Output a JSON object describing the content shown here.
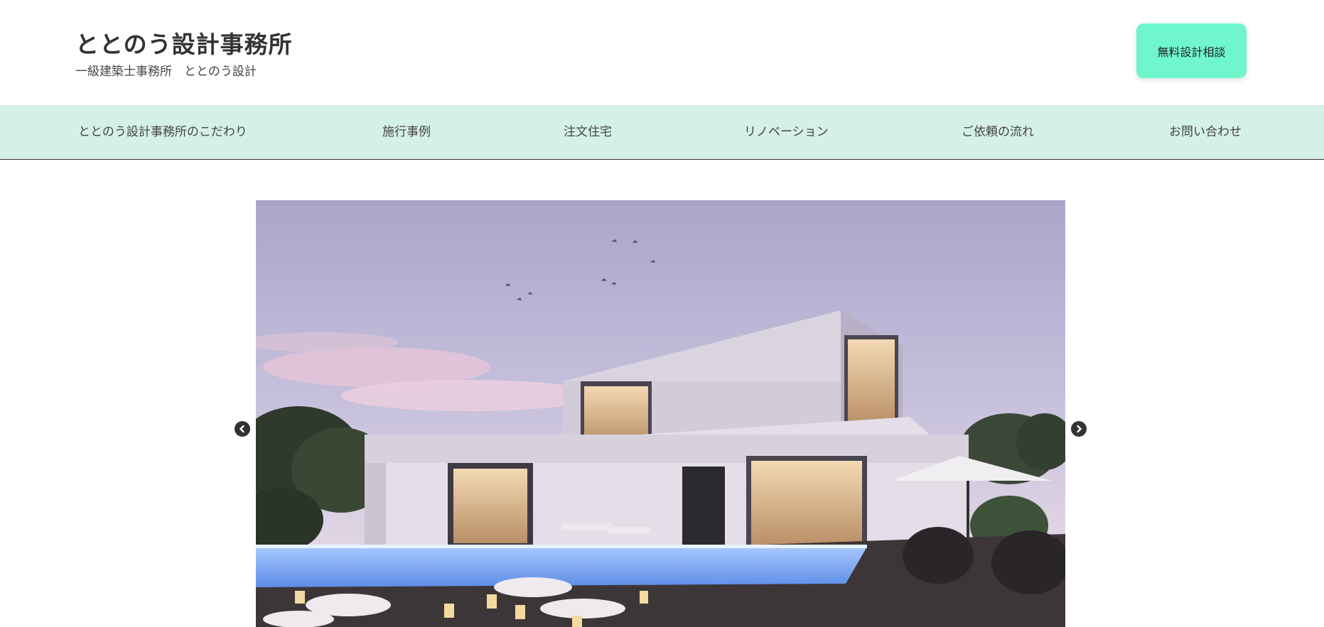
{
  "header": {
    "title": "ととのう設計事務所",
    "subtitle": "一級建築士事務所　ととのう設計",
    "cta_label": "無料設計相談"
  },
  "nav": {
    "items": [
      {
        "label": "ととのう設計事務所のこだわり"
      },
      {
        "label": "施行事例"
      },
      {
        "label": "注文住宅"
      },
      {
        "label": "リノベーション"
      },
      {
        "label": "ご依頼の流れ"
      },
      {
        "label": "お問い合わせ"
      }
    ]
  },
  "slider": {
    "prev_icon": "chevron-left-icon",
    "next_icon": "chevron-right-icon"
  },
  "colors": {
    "cta_bg": "#6ff6cd",
    "nav_bg": "#d5f1e7",
    "text": "#333333"
  }
}
